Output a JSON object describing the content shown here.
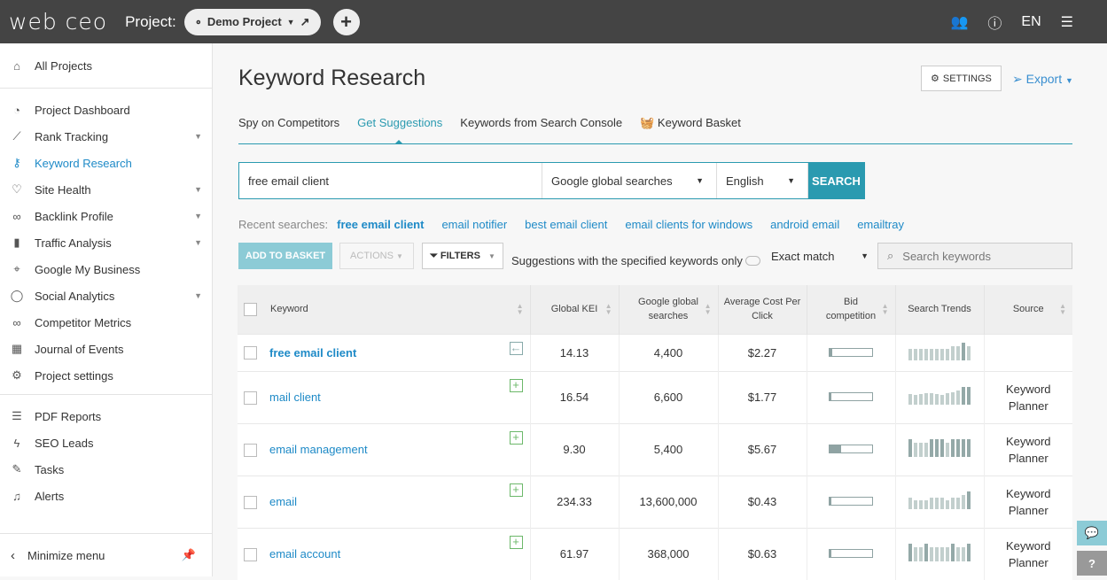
{
  "header": {
    "logo": "web ceo",
    "project_label": "Project:",
    "project_name": "Demo Project",
    "lang": "EN"
  },
  "sidebar": {
    "all_projects": "All Projects",
    "items": [
      {
        "label": "Project Dashboard",
        "icon": "gauge-icon",
        "g": "◔"
      },
      {
        "label": "Rank Tracking",
        "icon": "chart-line-icon",
        "g": "⟋",
        "caret": true
      },
      {
        "label": "Keyword Research",
        "icon": "key-icon",
        "g": "⚷",
        "active": true
      },
      {
        "label": "Site Health",
        "icon": "heart-pulse-icon",
        "g": "♡",
        "caret": true
      },
      {
        "label": "Backlink Profile",
        "icon": "link-icon",
        "g": "∞",
        "caret": true
      },
      {
        "label": "Traffic Analysis",
        "icon": "bar-chart-icon",
        "g": "▮",
        "caret": true
      },
      {
        "label": "Google My Business",
        "icon": "map-pin-icon",
        "g": "⌖"
      },
      {
        "label": "Social Analytics",
        "icon": "chat-bubble-icon",
        "g": "◯",
        "caret": true
      },
      {
        "label": "Competitor Metrics",
        "icon": "binoculars-icon",
        "g": "∞"
      },
      {
        "label": "Journal of Events",
        "icon": "calendar-icon",
        "g": "▦"
      },
      {
        "label": "Project settings",
        "icon": "gear-icon",
        "g": "⚙"
      }
    ],
    "items2": [
      {
        "label": "PDF Reports",
        "icon": "report-icon",
        "g": "☰"
      },
      {
        "label": "SEO Leads",
        "icon": "lightning-icon",
        "g": "ϟ"
      },
      {
        "label": "Tasks",
        "icon": "edit-icon",
        "g": "✎"
      },
      {
        "label": "Alerts",
        "icon": "bell-icon",
        "g": "♫"
      }
    ],
    "minimize": "Minimize menu"
  },
  "page": {
    "title": "Keyword Research",
    "settings": "SETTINGS",
    "export": "Export",
    "tabs": [
      "Spy on Competitors",
      "Get Suggestions",
      "Keywords from Search Console",
      "Keyword Basket"
    ],
    "active_tab": 1
  },
  "search": {
    "query": "free email client",
    "source": "Google global searches",
    "language": "English",
    "button": "SEARCH"
  },
  "recent": {
    "label": "Recent searches:",
    "items": [
      "free email client",
      "email notifier",
      "best email client",
      "email clients for windows",
      "android email",
      "emailtray"
    ]
  },
  "toolbar": {
    "add": "ADD TO BASKET",
    "actions": "ACTIONS",
    "filters": "FILTERS",
    "suggestions_toggle": "Suggestions with the specified keywords only",
    "match": "Exact match",
    "search_placeholder": "Search keywords"
  },
  "table": {
    "headers": [
      "Keyword",
      "Global KEI",
      "Google global searches",
      "Average Cost Per Click",
      "Bid competition",
      "Search Trends",
      "Source"
    ],
    "rows": [
      {
        "keyword": "free email client",
        "kei": "14.13",
        "searches": "4,400",
        "cpc": "$2.27",
        "bid": 0.07,
        "trend": [
          65,
          65,
          65,
          65,
          65,
          65,
          65,
          65,
          80,
          80,
          100,
          80
        ],
        "source": "",
        "bold": true
      },
      {
        "keyword": "mail client",
        "kei": "16.54",
        "searches": "6,600",
        "cpc": "$1.77",
        "bid": 0.05,
        "trend": [
          60,
          55,
          60,
          65,
          65,
          60,
          55,
          65,
          70,
          80,
          100,
          100
        ],
        "source": "Keyword Planner"
      },
      {
        "keyword": "email management",
        "kei": "9.30",
        "searches": "5,400",
        "cpc": "$5.67",
        "bid": 0.27,
        "trend": [
          100,
          80,
          80,
          80,
          100,
          100,
          100,
          80,
          100,
          100,
          100,
          100
        ],
        "source": "Keyword Planner"
      },
      {
        "keyword": "email",
        "kei": "234.33",
        "searches": "13,600,000",
        "cpc": "$0.43",
        "bid": 0,
        "trend": [
          65,
          50,
          50,
          50,
          65,
          65,
          65,
          50,
          65,
          65,
          80,
          100
        ],
        "source": "Keyword Planner"
      },
      {
        "keyword": "email account",
        "kei": "61.97",
        "searches": "368,000",
        "cpc": "$0.63",
        "bid": 0.05,
        "trend": [
          100,
          80,
          80,
          100,
          80,
          80,
          80,
          80,
          100,
          80,
          80,
          100
        ],
        "source": "Keyword Planner"
      }
    ]
  },
  "colors": {
    "accent": "#2a9ab0",
    "link": "#1e8ac7",
    "topbar": "#444444"
  }
}
